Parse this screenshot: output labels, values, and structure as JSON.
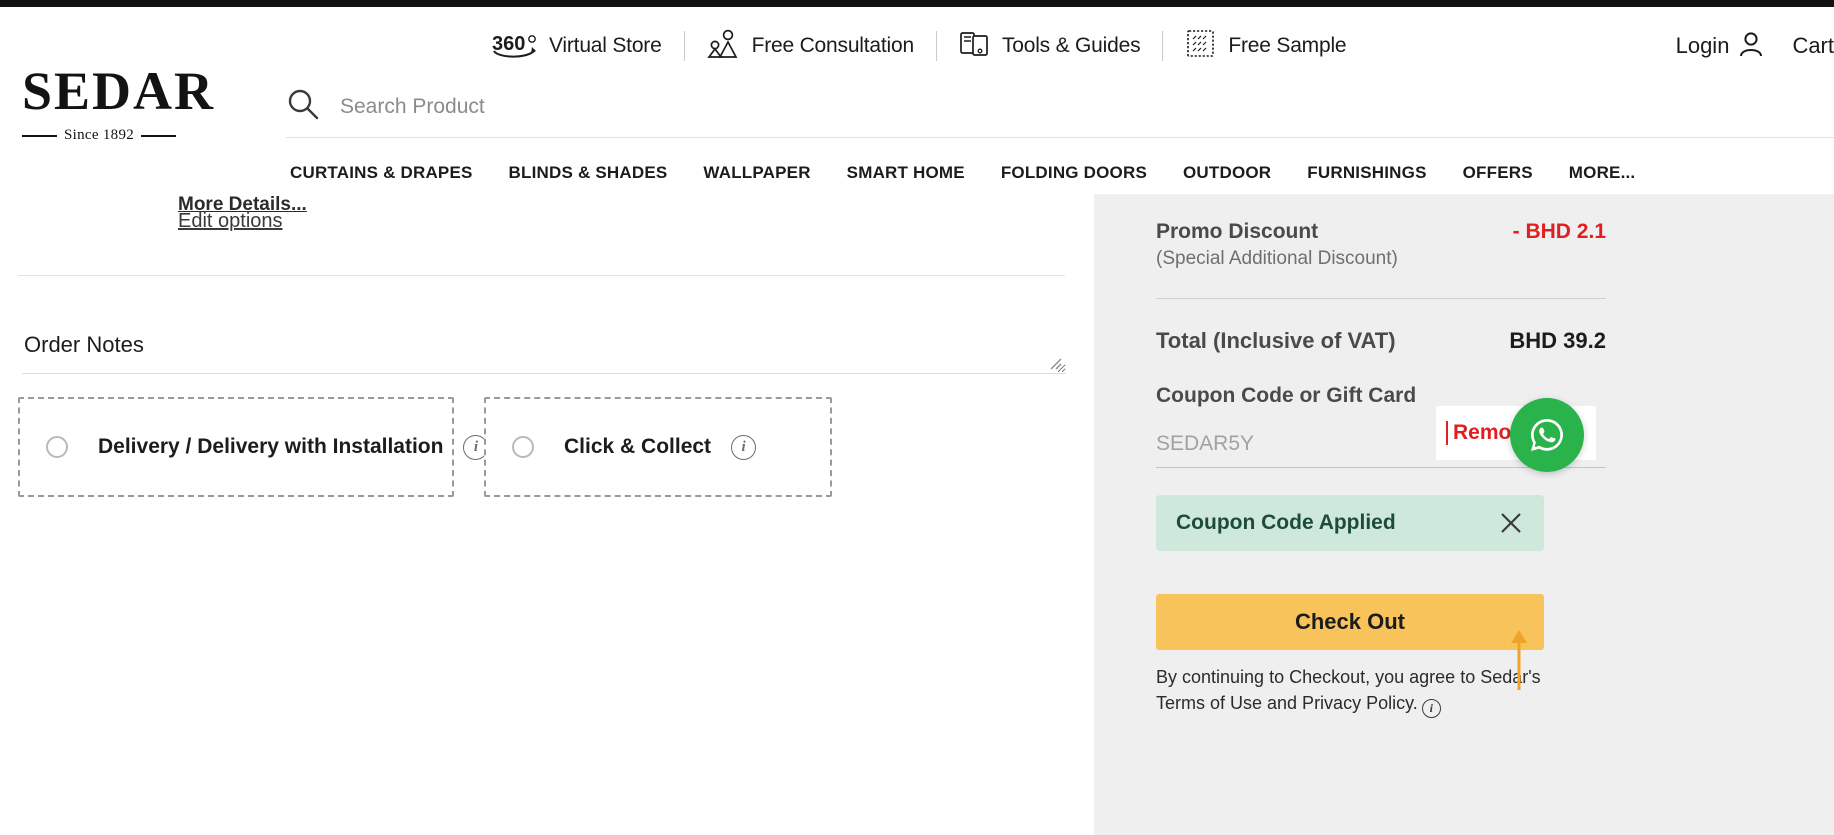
{
  "brand": {
    "name": "SEDAR",
    "tagline": "Since 1892"
  },
  "utility_nav": {
    "items": [
      {
        "label": "Virtual Store",
        "icon": "360-icon",
        "badge": "360"
      },
      {
        "label": "Free Consultation",
        "icon": "consultation-people-icon"
      },
      {
        "label": "Tools & Guides",
        "icon": "tools-guides-icon"
      },
      {
        "label": "Free Sample",
        "icon": "fabric-swatch-icon"
      }
    ],
    "login_label": "Login",
    "cart_label": "Cart"
  },
  "search": {
    "placeholder": "Search Product",
    "value": "",
    "icon": "search-icon"
  },
  "main_nav": {
    "items": [
      "CURTAINS & DRAPES",
      "BLINDS & SHADES",
      "WALLPAPER",
      "SMART HOME",
      "FOLDING DOORS",
      "OUTDOOR",
      "FURNISHINGS",
      "OFFERS",
      "MORE..."
    ]
  },
  "cart": {
    "more_details_label": "More Details...",
    "edit_options_label": "Edit options",
    "order_notes_label": "Order Notes",
    "order_notes_value": "",
    "order_notes_placeholder": "",
    "delivery_options": [
      {
        "label": "Delivery / Delivery with Installation",
        "selected": false,
        "info_icon": "info-icon"
      },
      {
        "label": "Click & Collect",
        "selected": false,
        "info_icon": "info-icon"
      }
    ]
  },
  "summary": {
    "promo_label": "Promo Discount",
    "promo_sublabel": "(Special Additional Discount)",
    "promo_amount": "-  BHD 2.1",
    "total_label": "Total (Inclusive of VAT)",
    "total_amount": "BHD 39.2",
    "coupon_title": "Coupon Code or Gift Card",
    "coupon_value": "SEDAR5Y",
    "coupon_placeholder": "SEDAR5Y",
    "remove_label": "Remove",
    "applied_banner": "Coupon Code Applied",
    "checkout_label": "Check Out",
    "terms_line1": "By continuing to Checkout, you agree to Sedar's",
    "terms_line2": "Terms of Use and Privacy Policy."
  },
  "floating": {
    "whatsapp_label": "whatsapp-icon"
  },
  "colors": {
    "discount_red": "#e02020",
    "checkout_amber": "#f8c35a",
    "applied_green_bg": "#cfe8dc",
    "applied_green_text": "#1d4d3a",
    "panel_grey": "#efefef",
    "whatsapp_green": "#2ab34a",
    "annotation_orange": "#f0a32a"
  }
}
